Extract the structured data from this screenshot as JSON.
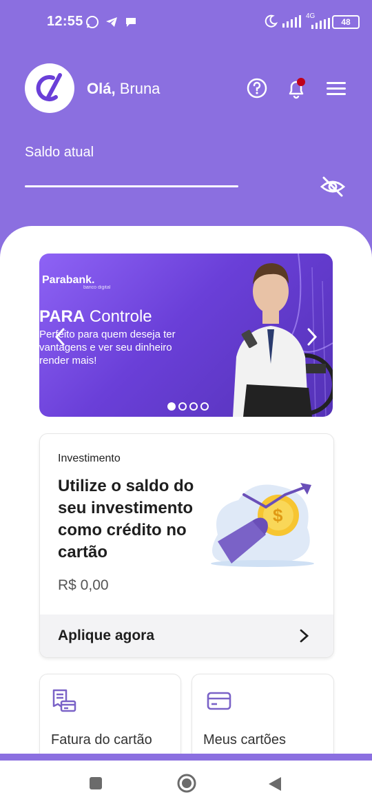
{
  "status": {
    "time": "12:55",
    "network": "4G",
    "battery": "48"
  },
  "header": {
    "greeting_bold": "Olá,",
    "user_name": "Bruna",
    "balance_label": "Saldo atual"
  },
  "banner": {
    "brand": "Parabank.",
    "brand_sub": "banco digital",
    "title_bold": "PARA",
    "title_rest": "Controle",
    "text": "Perfeito para quem deseja ter vantagens e ver seu dinheiro render mais!",
    "slides": 4,
    "active_slide": 1
  },
  "invest_card": {
    "category": "Investimento",
    "title": "Utilize o saldo do seu investimento como crédito no cartão",
    "value": "R$ 0,00",
    "cta": "Aplique agora"
  },
  "tiles": [
    {
      "label": "Fatura do cartão",
      "icon": "invoice-icon"
    },
    {
      "label": "Meus cartões",
      "icon": "card-icon"
    }
  ],
  "colors": {
    "primary": "#8b6fe0",
    "banner_dark": "#5432b6",
    "notification": "#c0001a"
  }
}
